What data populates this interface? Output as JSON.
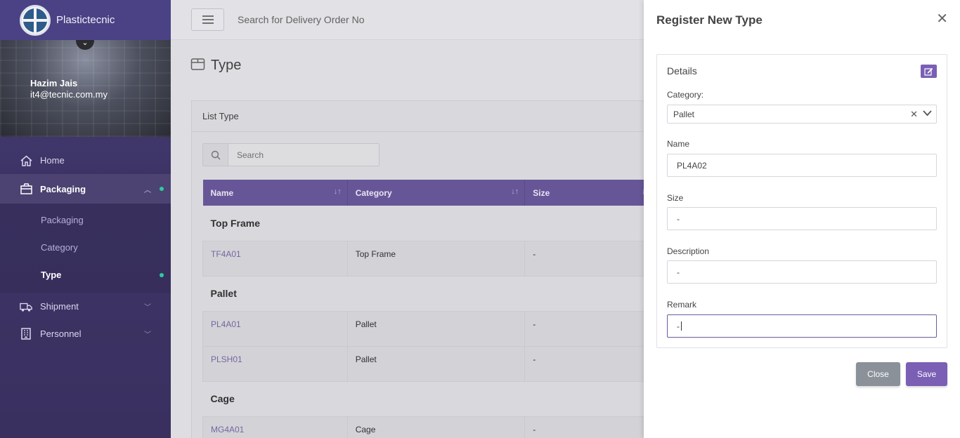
{
  "brand": {
    "name": "Plastictecnic"
  },
  "profile": {
    "name": "Hazim Jais",
    "email": "it4@tecnic.com.my"
  },
  "nav": {
    "home": "Home",
    "packaging": "Packaging",
    "sub": [
      "Packaging",
      "Category",
      "Type"
    ],
    "shipment": "Shipment",
    "personnel": "Personnel"
  },
  "topbar": {
    "search_placeholder": "Search for Delivery Order No"
  },
  "page": {
    "title": "Type"
  },
  "list": {
    "title": "List Type",
    "search_placeholder": "Search",
    "columns": [
      "Name",
      "Category",
      "Size"
    ],
    "groups": [
      {
        "label": "Top Frame",
        "rows": [
          {
            "name": "TF4A01",
            "category": "Top Frame",
            "size": "-"
          }
        ]
      },
      {
        "label": "Pallet",
        "rows": [
          {
            "name": "PL4A01",
            "category": "Pallet",
            "size": "-"
          },
          {
            "name": "PLSH01",
            "category": "Pallet",
            "size": "-"
          }
        ]
      },
      {
        "label": "Cage",
        "rows": [
          {
            "name": "MG4A01",
            "category": "Cage",
            "size": "-"
          }
        ]
      }
    ]
  },
  "drawer": {
    "title": "Register New Type",
    "details_heading": "Details",
    "category_label": "Category:",
    "category_value": "Pallet",
    "name_label": "Name",
    "name_value": "PL4A02",
    "size_label": "Size",
    "size_value": "-",
    "description_label": "Description",
    "description_value": "-",
    "remark_label": "Remark",
    "remark_value": "-",
    "close_label": "Close",
    "save_label": "Save"
  },
  "colors": {
    "accent": "#6c5a9e",
    "button_primary": "#7a5fb5",
    "button_secondary": "#8a9199",
    "active_dot": "#2ecc9a"
  }
}
